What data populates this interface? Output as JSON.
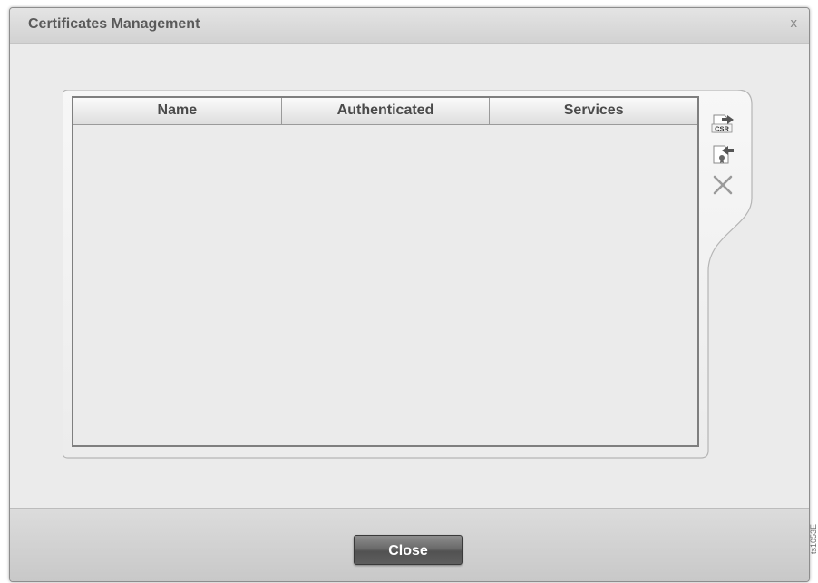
{
  "dialog": {
    "title": "Certificates Management",
    "close_glyph": "x"
  },
  "table": {
    "columns": [
      "Name",
      "Authenticated",
      "Services"
    ],
    "rows": []
  },
  "toolbar": {
    "icons": [
      "csr-export-icon",
      "certificate-import-icon",
      "delete-icon"
    ],
    "csr_label": "CSR"
  },
  "footer": {
    "close_label": "Close"
  },
  "figure_id": "ts1053E",
  "colors": {
    "dialog_bg": "#e5e5e5",
    "button_dark": "#5e5e5e",
    "header_text": "#4a4a4a"
  }
}
